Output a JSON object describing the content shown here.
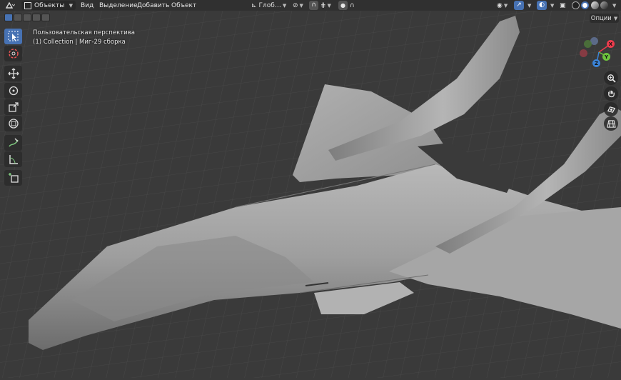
{
  "header": {
    "mode_select": "Объекты",
    "menu_view": "Вид",
    "menu_select": "Выделение",
    "menu_add": "Добавить",
    "menu_object": "Объект",
    "transform_orientation": "Глоб…"
  },
  "overlay": {
    "view_name": "Пользовательская перспектива",
    "collection_line": "(1) Collection | Миг-29 сборка"
  },
  "options_label": "Опции",
  "gizmo": {
    "x": "X",
    "y": "Y",
    "z": "Z"
  },
  "colors": {
    "accent": "#4772b3",
    "header_bg": "#303030",
    "viewport_bg": "#3a3a3a",
    "grid": "#4a4a4a",
    "model": "#9a9a9a",
    "axis_x": "#ed3c4d",
    "axis_y": "#6dc33d",
    "axis_z": "#3b83d6"
  },
  "icons": {
    "toolbar": [
      "select-cursor-icon",
      "cursor-icon",
      "move-icon",
      "rotate-icon",
      "scale-icon",
      "transform-icon",
      "annotate-icon",
      "measure-icon",
      "add-cube-icon"
    ],
    "navigation": [
      "zoom-icon",
      "hand-pan-icon",
      "camera-icon",
      "grid-ortho-icon"
    ]
  }
}
